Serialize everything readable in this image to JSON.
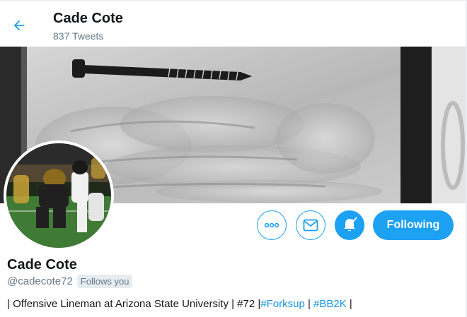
{
  "header": {
    "name": "Cade Cote",
    "tweet_count": "837 Tweets"
  },
  "profile": {
    "name": "Cade Cote",
    "handle": "@cadecote72",
    "follows_you": "Follows you",
    "bio": {
      "prefix": "| Offensive Lineman at Arizona State University | #72 |",
      "hashtag1": "#Forksup",
      "separator": " | ",
      "hashtag2": "#BB2K",
      "suffix": " |"
    }
  },
  "actions": {
    "following_label": "Following"
  },
  "icons": {
    "back": "back-arrow-icon",
    "more": "more-icon",
    "message": "envelope-icon",
    "notifications": "bell-icon"
  },
  "colors": {
    "accent": "#1da1f2",
    "hashtag": "#1b95e0",
    "secondary_text": "#657786"
  }
}
